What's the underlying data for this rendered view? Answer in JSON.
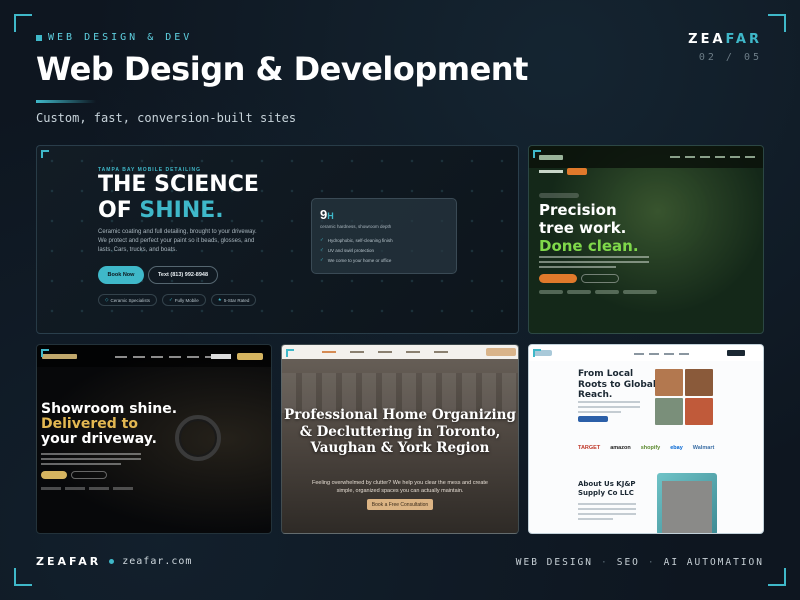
{
  "header": {
    "eyebrow": "WEB DESIGN & DEV",
    "title": "Web Design & Development",
    "subtitle": "Custom, fast, conversion-built sites",
    "brand_main": "ZEA",
    "brand_accent": "FAR",
    "page_indicator": "02 / 05"
  },
  "cards": {
    "detailing": {
      "kicker": "TAMPA BAY MOBILE DETAILING",
      "headline_line1": "THE SCIENCE",
      "headline_of": "OF ",
      "headline_highlight": "SHINE.",
      "description": "Ceramic coating and full detailing, brought to your driveway. We protect and perfect your paint so it beads, glosses, and lasts. Cars, trucks, and boats.",
      "book_button": "Book Now",
      "phone_button": "Text (813) 992-8948",
      "chips": [
        "Ceramic Specialists",
        "Fully Mobile",
        "5-Star Rated"
      ],
      "panel_value": "9",
      "panel_unit": "H",
      "panel_caption": "ceramic hardness, showroom depth",
      "panel_list": [
        "Hydrophobic, self-cleaning finish",
        "UV and swirl protection",
        "We come to your home or office"
      ]
    },
    "tree": {
      "headline_line1": "Precision",
      "headline_line2": "tree work.",
      "headline_line3": "Done clean."
    },
    "auto": {
      "headline_line1": "Showroom shine.",
      "headline_line2": "Delivered to",
      "headline_line3": "your driveway."
    },
    "organizing": {
      "headline": "Professional Home Organizing & Decluttering in Toronto, Vaughan & York Region",
      "subtext": "Feeling overwhelmed by clutter? We help you clear the mess and create simple, organized spaces you can actually maintain.",
      "button": "Book a Free Consultation"
    },
    "supply": {
      "headline_line1": "From Local",
      "headline_line2": "Roots to Global",
      "headline_line3": "Reach.",
      "partners": [
        "TARGET",
        "amazon",
        "shopify",
        "ebay",
        "Walmart"
      ],
      "about_line1": "About Us KJ&P",
      "about_line2": "Supply Co LLC"
    }
  },
  "footer": {
    "brand": "ZEAFAR",
    "url": "zeafar.com",
    "services": [
      "WEB DESIGN",
      "SEO",
      "AI AUTOMATION"
    ],
    "separator": "·"
  },
  "colors": {
    "accent": "#3fb8c9",
    "background": "#0e1620",
    "green_accent": "#7fd84a",
    "gold_accent": "#e3b852"
  }
}
